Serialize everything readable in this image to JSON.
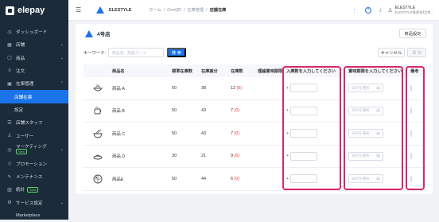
{
  "sidebar": {
    "brand": "elepay",
    "items": [
      {
        "icon": "◷",
        "label": "ダッシュボード"
      },
      {
        "icon": "▦",
        "label": "店舗",
        "caret": "⌄"
      },
      {
        "icon": "▢",
        "label": "商品",
        "caret": "⌄"
      },
      {
        "icon": "≡",
        "label": "注文"
      },
      {
        "icon": "▣",
        "label": "在庫管理",
        "caret": "⌃"
      },
      {
        "label": "店舗在庫"
      },
      {
        "label": "設定"
      },
      {
        "icon": "☰",
        "label": "店舗スタッフ"
      },
      {
        "icon": "♙",
        "label": "ユーザー"
      },
      {
        "icon": "◎",
        "label": "マーケティング",
        "badge": "New",
        "caret": "⌄"
      },
      {
        "icon": "◇",
        "label": "プロモーション"
      },
      {
        "icon": "✎",
        "label": "メンテナンス"
      },
      {
        "icon": "▥",
        "label": "統計",
        "badge": "Beta"
      },
      {
        "icon": "⚙",
        "label": "サービス設定",
        "caret": "⌄"
      },
      {
        "icon": "",
        "label": "Marketplace"
      }
    ]
  },
  "topbar": {
    "menu_icon": "☰",
    "store_name": "ELESTYLE",
    "breadcrumb": [
      "ホーム",
      "OneQR",
      "在庫管理",
      "店舗在庫"
    ],
    "separator": "/",
    "notification_icon": "⋮",
    "help_icon": "?",
    "download_icon": "⤓",
    "user_icon": "♙",
    "user_name": "ELESTYLE",
    "user_company": "ELESTYLE株式会社(本..."
  },
  "page": {
    "title": "4号店",
    "settings_button": "商品設定",
    "search_label": "キーワード:",
    "search_placeholder": "商品名、商品コード",
    "search_button": "検 索",
    "cancel_button": "キャンセル",
    "save_button": "保 存"
  },
  "table": {
    "headers": {
      "name": "商品名",
      "standard": "標準在庫数",
      "diff": "在庫差分",
      "stock": "在庫数",
      "ideal": "理論賞味期限",
      "inqty": "入庫数を入力してください",
      "expiry": "賞味期限を入力してください",
      "memo": "備考"
    },
    "qty_prefix": "+",
    "date_placeholder": "日付を選択",
    "calendar_icon": "▤",
    "rows": [
      {
        "icon": "bowl",
        "name": "商品 A",
        "standard": "50",
        "diff": "38",
        "stock": "12",
        "stock_paren": "(0)"
      },
      {
        "icon": "cup",
        "name": "商品 B",
        "standard": "50",
        "diff": "43",
        "stock": "7",
        "stock_paren": "(0)"
      },
      {
        "icon": "noodle",
        "name": "商品 C",
        "standard": "50",
        "diff": "43",
        "stock": "7",
        "stock_paren": "(0)"
      },
      {
        "icon": "dish",
        "name": "商品 D",
        "standard": "30",
        "diff": "21",
        "stock": "9",
        "stock_paren": "(0)"
      },
      {
        "icon": "bento",
        "name": "商品E",
        "standard": "50",
        "diff": "44",
        "stock": "6",
        "stock_paren": "(0)"
      }
    ]
  },
  "colors": {
    "accent": "#1a73e8",
    "highlight": "#d9276e",
    "sidebar": "#1c2b3a",
    "warning": "#e53935"
  }
}
